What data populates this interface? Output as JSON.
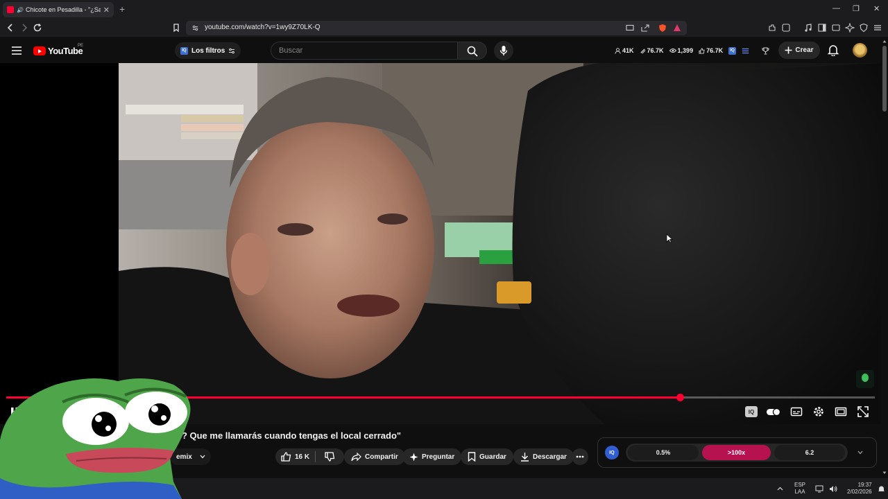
{
  "browser": {
    "tab_title": "Chicote en Pesadilla - \"¿Sabe",
    "new_tab": "+",
    "url": "youtube.com/watch?v=1wy9Z70LK-Q"
  },
  "masthead": {
    "logo_text": "YouTube",
    "country_code": "PE",
    "filters_label": "Los filtros",
    "search_placeholder": "Buscar",
    "stats": [
      "41K",
      "76.7K",
      "1,399",
      "76.7K"
    ],
    "create_label": "Crear"
  },
  "player": {
    "progress": 0.776,
    "accent": "#ff0033"
  },
  "video": {
    "title": "o? Que me llamarás cuando tengas el local cerrado\"",
    "channel_fragment": "emix",
    "likes": "16 K",
    "share_label": "Compartir",
    "ask_label": "Preguntar",
    "save_label": "Guardar",
    "download_label": "Descargar"
  },
  "iq_panel": {
    "segments": [
      "0.5%",
      ">100x",
      "6.2"
    ],
    "highlight_color": "#b5124f"
  },
  "taskbar": {
    "lang_top": "ESP",
    "lang_bottom": "LAA",
    "time": "19:37",
    "date": "2/02/2026"
  }
}
